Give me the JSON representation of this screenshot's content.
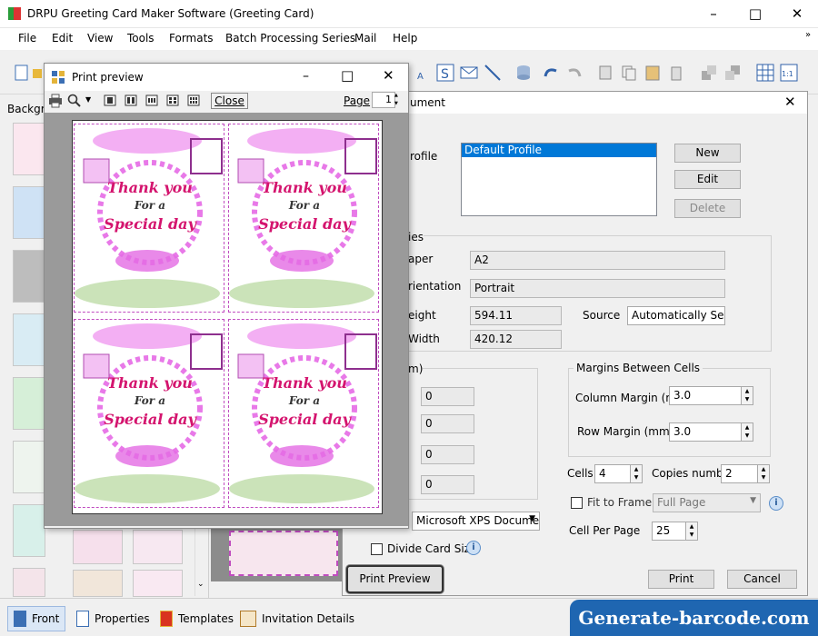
{
  "app": {
    "title": "DRPU Greeting Card Maker Software (Greeting Card)"
  },
  "menu": [
    "File",
    "Edit",
    "View",
    "Tools",
    "Formats",
    "Batch Processing Series",
    "Mail",
    "Help"
  ],
  "left_panel": {
    "heading": "Backgr"
  },
  "preview": {
    "title": "Print preview",
    "close_label": "Close",
    "page_label": "Page",
    "page_value": "1",
    "card": {
      "line1": "Thank you",
      "line2": "For a",
      "line3": "Special day"
    }
  },
  "dialog": {
    "title_suffix": "ument",
    "profile_label": "rofile",
    "profiles": [
      "Default Profile"
    ],
    "new_label": "New",
    "edit_label": "Edit",
    "delete_label": "Delete",
    "properties_heading": "ies",
    "paper_label": "aper",
    "paper_value": "A2",
    "orientation_label": "rientation",
    "orientation_value": "Portrait",
    "height_label": "eight",
    "height_value": "594.11",
    "source_label": "Source",
    "source_value": "Automatically Selec",
    "width_label": "Width",
    "width_value": "420.12",
    "margins_heading": "m)",
    "margin_values": [
      "0",
      "0",
      "0",
      "0"
    ],
    "between_heading": "Margins Between Cells",
    "column_margin_label": "Column Margin (mm)",
    "column_margin_value": "3.0",
    "row_margin_label": "Row Margin (mm)",
    "row_margin_value": "3.0",
    "cells_label": "Cells",
    "cells_value": "4",
    "copies_label": "Copies number",
    "copies_value": "2",
    "fit_label": "Fit to Frame",
    "fit_select": "Full Page",
    "cell_per_page_label": "Cell Per Page",
    "cell_per_page_value": "25",
    "printer_value": "Microsoft XPS Document",
    "divide_label": "Divide Card Size",
    "print_preview_label": "Print Preview",
    "print_label": "Print",
    "cancel_label": "Cancel"
  },
  "bottom_tabs": [
    "Front",
    "Properties",
    "Templates",
    "Invitation Details"
  ],
  "watermark": "Generate-barcode.com",
  "colors": {
    "accent": "#1f66b1",
    "card_text": "#d4146e",
    "floral": "#e879e8"
  }
}
